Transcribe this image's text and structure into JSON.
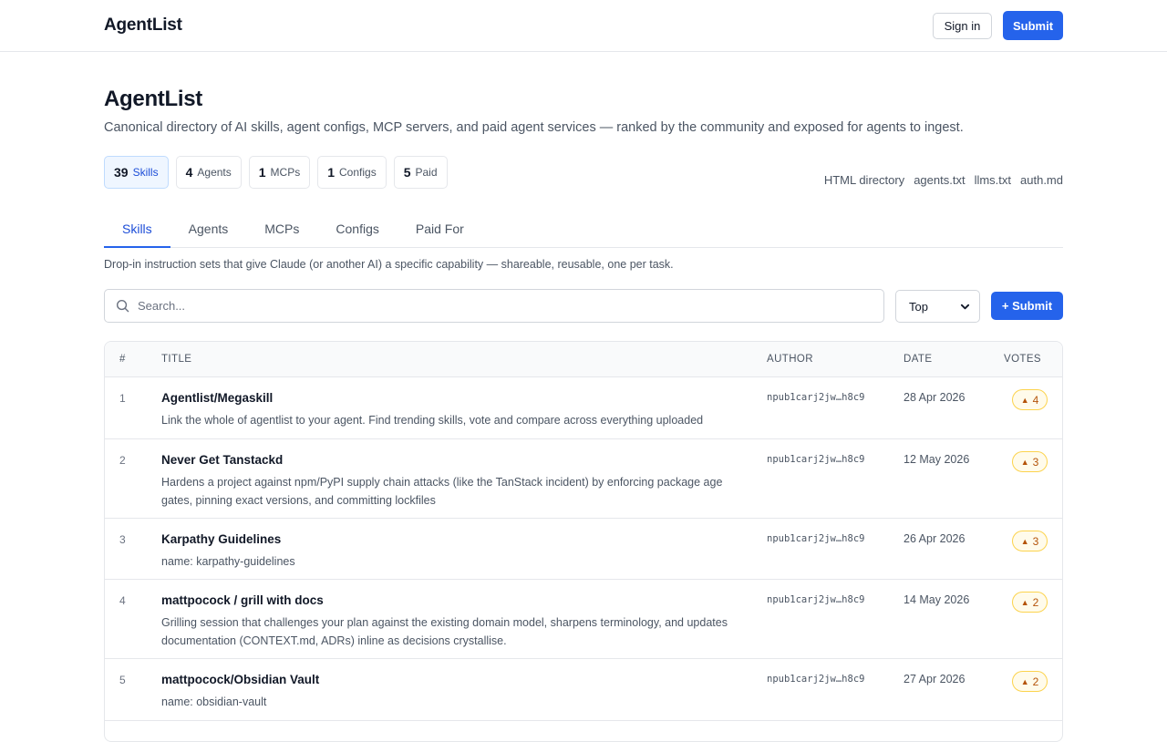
{
  "header": {
    "brand": "AgentList",
    "sign_in_label": "Sign in",
    "submit_label": "Submit"
  },
  "hero": {
    "title": "AgentList",
    "tagline": "Canonical directory of AI skills, agent configs, MCP servers, and paid agent services — ranked by the community and exposed for agents to ingest."
  },
  "stats": [
    {
      "count": "39",
      "label": "Skills",
      "active": true
    },
    {
      "count": "4",
      "label": "Agents",
      "active": false
    },
    {
      "count": "1",
      "label": "MCPs",
      "active": false
    },
    {
      "count": "1",
      "label": "Configs",
      "active": false
    },
    {
      "count": "5",
      "label": "Paid",
      "active": false
    }
  ],
  "ext_links": [
    "HTML directory",
    "agents.txt",
    "llms.txt",
    "auth.md"
  ],
  "tabs": [
    {
      "label": "Skills",
      "active": true
    },
    {
      "label": "Agents",
      "active": false
    },
    {
      "label": "MCPs",
      "active": false
    },
    {
      "label": "Configs",
      "active": false
    },
    {
      "label": "Paid For",
      "active": false
    }
  ],
  "tab_description": "Drop-in instruction sets that give Claude (or another AI) a specific capability — shareable, reusable, one per task.",
  "search": {
    "placeholder": "Search...",
    "value": ""
  },
  "sort": {
    "selected": "Top"
  },
  "submit_add_label": "+ Submit",
  "table": {
    "headers": {
      "index": "#",
      "title": "TITLE",
      "author": "AUTHOR",
      "date": "DATE",
      "votes": "VOTES"
    },
    "rows": [
      {
        "index": "1",
        "title": "Agentlist/Megaskill",
        "description": "Link the whole of agentlist to your agent. Find trending skills, vote and compare across everything uploaded",
        "author": "npub1carj2jw…h8c9",
        "date": "28 Apr 2026",
        "votes": "4"
      },
      {
        "index": "2",
        "title": "Never Get Tanstackd",
        "description": "Hardens a project against npm/PyPI supply chain attacks (like the TanStack incident) by enforcing package age gates, pinning exact versions, and committing lockfiles",
        "author": "npub1carj2jw…h8c9",
        "date": "12 May 2026",
        "votes": "3"
      },
      {
        "index": "3",
        "title": "Karpathy Guidelines",
        "description": "name: karpathy-guidelines",
        "author": "npub1carj2jw…h8c9",
        "date": "26 Apr 2026",
        "votes": "3"
      },
      {
        "index": "4",
        "title": "mattpocock / grill with docs",
        "description": "Grilling session that challenges your plan against the existing domain model, sharpens terminology, and updates documentation (CONTEXT.md, ADRs) inline as decisions crystallise.",
        "author": "npub1carj2jw…h8c9",
        "date": "14 May 2026",
        "votes": "2"
      },
      {
        "index": "5",
        "title": "mattpocock/Obsidian Vault",
        "description": "name: obsidian-vault",
        "author": "npub1carj2jw…h8c9",
        "date": "27 Apr 2026",
        "votes": "2"
      }
    ]
  },
  "colors": {
    "accent": "#2563eb",
    "vote_bg": "#fffbeb",
    "vote_border": "#fcd34d",
    "vote_text": "#b45309"
  },
  "icons": {
    "search": "search-icon",
    "sort_arrow": "chevron-down-icon",
    "vote": "triangle-up-icon"
  }
}
